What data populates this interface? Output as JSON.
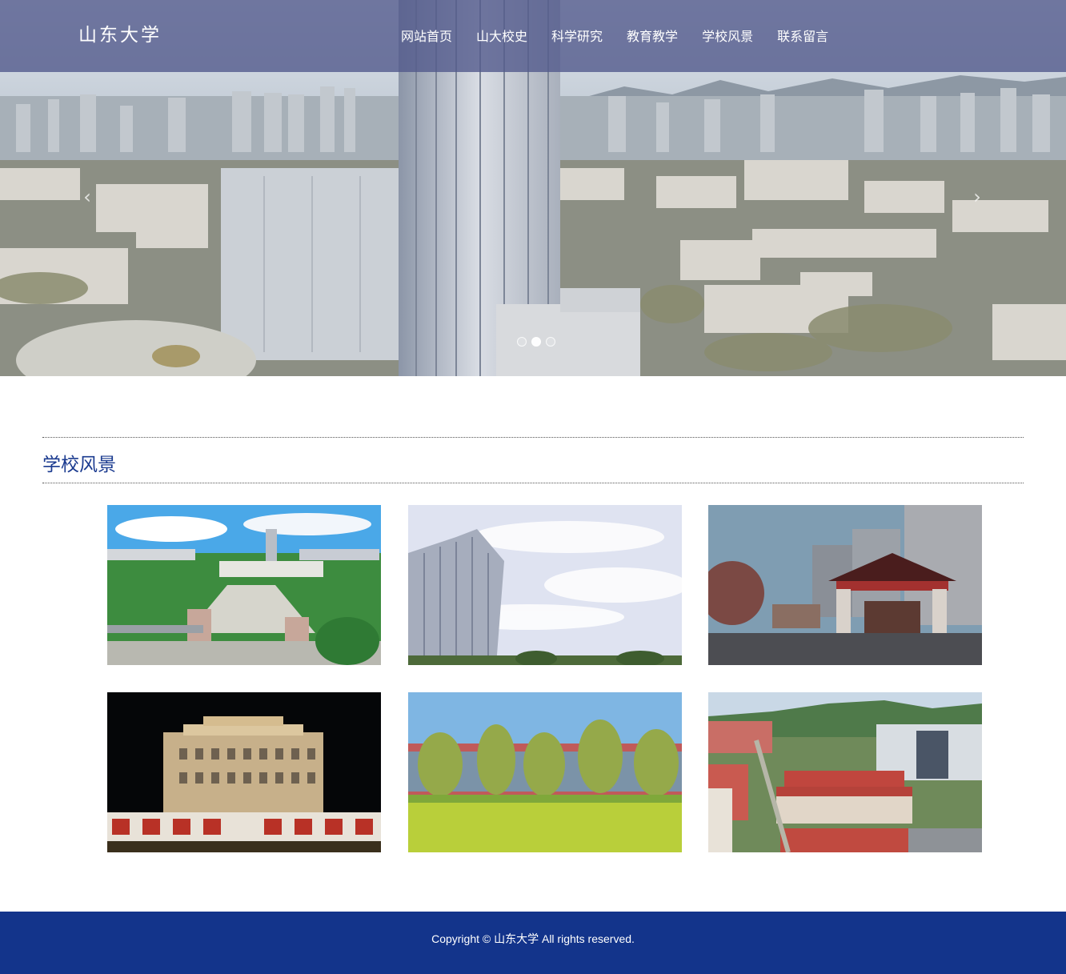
{
  "header": {
    "logo": "山东大学",
    "nav": [
      "网站首页",
      "山大校史",
      "科学研究",
      "教育教学",
      "学校风景",
      "联系留言"
    ]
  },
  "banner": {
    "prev_icon": "chevron-left-icon",
    "next_icon": "chevron-right-icon",
    "slide_count": 3,
    "active_slide": 2
  },
  "gallery": {
    "title": "学校风景",
    "photos": [
      "campus-aerial-gate",
      "tower-against-sky",
      "traditional-gate-dusk",
      "library-at-night",
      "lawn-and-trees",
      "campus-aerial-red-roofs"
    ]
  },
  "footer": {
    "copyright": "Copyright © 山东大学 All rights reserved."
  },
  "colors": {
    "header_overlay": "#525a8c",
    "title": "#1a3a8f",
    "footer": "#13348b"
  }
}
